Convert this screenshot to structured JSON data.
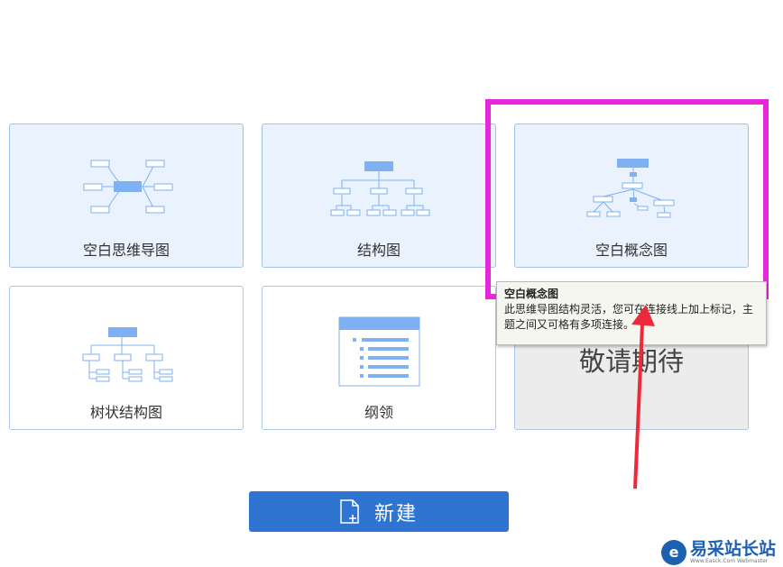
{
  "templates": [
    {
      "label": "空白思维导图",
      "icon": "mindmap-icon"
    },
    {
      "label": "结构图",
      "icon": "org-chart-icon"
    },
    {
      "label": "空白概念图",
      "icon": "concept-map-icon"
    },
    {
      "label": "树状结构图",
      "icon": "tree-chart-icon"
    },
    {
      "label": "纲领",
      "icon": "outline-icon"
    }
  ],
  "coming_soon": "敬请期待",
  "tooltip": {
    "title": "空白概念图",
    "body": "此思维导图结构灵活，您可在连接线上加上标记，主题之间又可格有多项连接。"
  },
  "new_button": {
    "label": "新建",
    "icon": "new-file-icon"
  },
  "watermark": {
    "text": "易采站长站",
    "sub": "Www.Easck.Com Webmaster"
  },
  "colors": {
    "accent": "#3074d2",
    "card_border": "#a9c8ec",
    "selected_bg": "#e9f2fd",
    "icon_blue": "#7fb1f2",
    "highlight": "#e628d8",
    "arrow": "#ee2a3a"
  }
}
